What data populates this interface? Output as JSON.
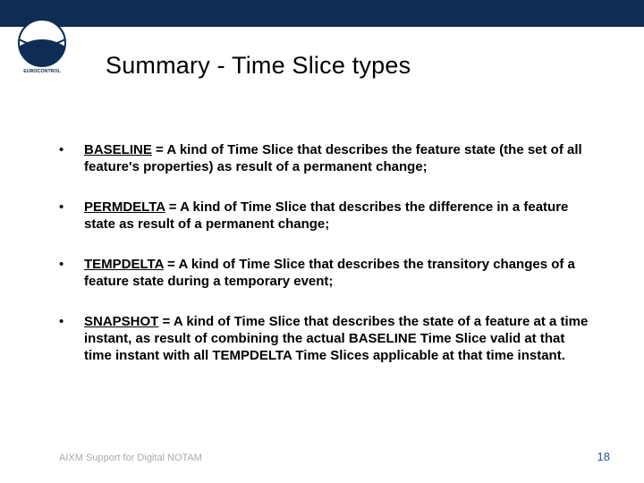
{
  "title": "Summary - Time Slice types",
  "bullets": [
    {
      "term": "BASELINE",
      "sep": " = ",
      "desc": "A kind of Time Slice that describes the feature state (the set of all feature's properties) as result of a permanent change;"
    },
    {
      "term": "PERMDELTA",
      "sep": " = ",
      "desc": "A kind of Time Slice that describes the difference in a feature state as result of a permanent change;"
    },
    {
      "term": "TEMPDELTA",
      "sep": " = ",
      "desc": "A kind of Time Slice that describes the transitory changes of a feature state during a temporary event;"
    },
    {
      "term": "SNAPSHOT",
      "sep": " = ",
      "desc": "A kind of Time Slice that describes the state of a feature at a time instant, as result of combining the actual BASELINE Time Slice valid at that time instant with all TEMPDELTA Time Slices applicable at that time instant."
    }
  ],
  "footer_left": "AIXM Support for Digital NOTAM",
  "page_number": "18",
  "bullet_char": "•",
  "logo_label": "EUROCONTROL"
}
